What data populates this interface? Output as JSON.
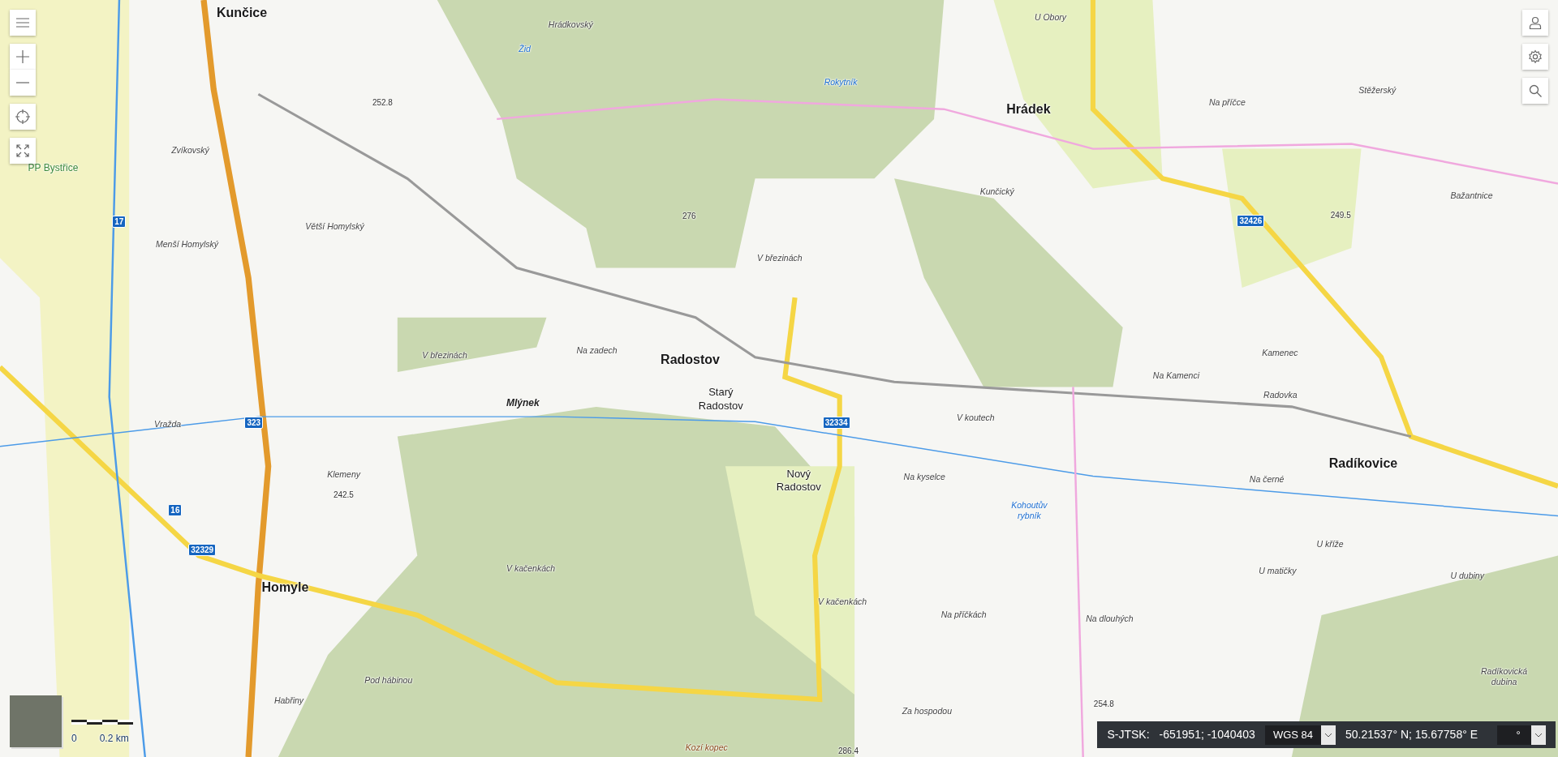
{
  "map_labels": [
    {
      "text": "Kunčice",
      "kind": "town"
    },
    {
      "text": "Hrádek",
      "kind": "town"
    },
    {
      "text": "Radostov",
      "kind": "town"
    },
    {
      "text": "Starý Radostov",
      "kind": "village"
    },
    {
      "text": "Nový Radostov",
      "kind": "village"
    },
    {
      "text": "Radíkovice",
      "kind": "town"
    },
    {
      "text": "Homyle",
      "kind": "town"
    },
    {
      "text": "Hrádkovský",
      "kind": "locality"
    },
    {
      "text": "Rokytník",
      "kind": "water"
    },
    {
      "text": "Žid",
      "kind": "water"
    },
    {
      "text": "U Obory",
      "kind": "locality"
    },
    {
      "text": "Na příčce",
      "kind": "locality"
    },
    {
      "text": "Stěžerský",
      "kind": "locality"
    },
    {
      "text": "Kunčický",
      "kind": "locality"
    },
    {
      "text": "Bažantnice",
      "kind": "locality"
    },
    {
      "text": "V březinách",
      "kind": "locality"
    },
    {
      "text": "Zvíkovský",
      "kind": "locality"
    },
    {
      "text": "PP Bystřice",
      "kind": "reserve"
    },
    {
      "text": "Větší Homylský",
      "kind": "locality"
    },
    {
      "text": "Menší Homylský",
      "kind": "locality"
    },
    {
      "text": "V březinách",
      "kind": "locality"
    },
    {
      "text": "Na zadech",
      "kind": "locality"
    },
    {
      "text": "Mlýnek",
      "kind": "hamlet"
    },
    {
      "text": "Na Kamenci",
      "kind": "locality"
    },
    {
      "text": "Kamenec",
      "kind": "locality"
    },
    {
      "text": "Radovka",
      "kind": "locality"
    },
    {
      "text": "V koutech",
      "kind": "locality"
    },
    {
      "text": "Vražda",
      "kind": "locality"
    },
    {
      "text": "Klemeny",
      "kind": "locality"
    },
    {
      "text": "Na kyselce",
      "kind": "locality"
    },
    {
      "text": "Kohoutův rybník",
      "kind": "water"
    },
    {
      "text": "Na černé",
      "kind": "locality"
    },
    {
      "text": "U kříže",
      "kind": "locality"
    },
    {
      "text": "U matičky",
      "kind": "locality"
    },
    {
      "text": "U dubiny",
      "kind": "locality"
    },
    {
      "text": "V kačenkách",
      "kind": "locality"
    },
    {
      "text": "V kačenkách",
      "kind": "locality"
    },
    {
      "text": "Na příčkách",
      "kind": "locality"
    },
    {
      "text": "Na dlouhých",
      "kind": "locality"
    },
    {
      "text": "Pod hábinou",
      "kind": "locality"
    },
    {
      "text": "Habřiny",
      "kind": "locality"
    },
    {
      "text": "Za hospodou",
      "kind": "locality"
    },
    {
      "text": "Radíkovická dubina",
      "kind": "locality"
    },
    {
      "text": "Kozí kopec",
      "kind": "hill"
    },
    {
      "text": "323",
      "kind": "road"
    },
    {
      "text": "32334",
      "kind": "road"
    },
    {
      "text": "32426",
      "kind": "road"
    },
    {
      "text": "32329",
      "kind": "road"
    },
    {
      "text": "17",
      "kind": "road"
    },
    {
      "text": "16",
      "kind": "road"
    },
    {
      "text": "252.8",
      "kind": "elevation"
    },
    {
      "text": "276",
      "kind": "elevation"
    },
    {
      "text": "249.5",
      "kind": "elevation"
    },
    {
      "text": "242.5",
      "kind": "elevation"
    },
    {
      "text": "254.8",
      "kind": "elevation"
    },
    {
      "text": "286.4",
      "kind": "elevation"
    }
  ],
  "scale": {
    "start": "0",
    "end": "0.2 km"
  },
  "coords": {
    "system_label": "S-JTSK:",
    "system_value": "-651951; -1040403",
    "datum": "WGS 84",
    "wgs_value": "50.21537° N; 15.67758° E",
    "format": "°"
  }
}
